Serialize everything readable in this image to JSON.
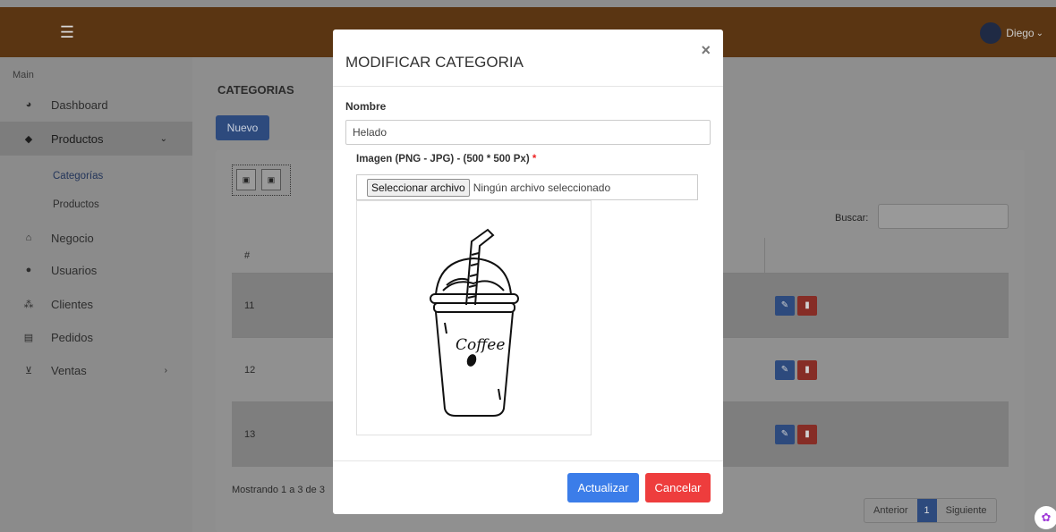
{
  "topbar": {
    "user_name": "Diego",
    "user_caret": "⌄"
  },
  "sidebar": {
    "section_label": "Main",
    "items": [
      {
        "label": "Dashboard",
        "icon": "pie-chart-icon"
      },
      {
        "label": "Productos",
        "icon": "tags-icon"
      },
      {
        "label": "Negocio",
        "icon": "home-icon"
      },
      {
        "label": "Usuarios",
        "icon": "user-icon"
      },
      {
        "label": "Clientes",
        "icon": "users-icon"
      },
      {
        "label": "Pedidos",
        "icon": "list-icon"
      },
      {
        "label": "Ventas",
        "icon": "cart-icon"
      }
    ],
    "subitems": [
      {
        "label": "Categorías"
      },
      {
        "label": "Productos"
      }
    ]
  },
  "main": {
    "title": "CATEGORIAS",
    "new_button": "Nuevo",
    "search_label": "Buscar:",
    "table": {
      "header_first": "#",
      "rows": [
        {
          "id": "11"
        },
        {
          "id": "12"
        },
        {
          "id": "13"
        }
      ]
    },
    "showing_text": "Mostrando 1 a 3 de 3",
    "pagination": {
      "prev": "Anterior",
      "current": "1",
      "next": "Siguiente"
    }
  },
  "modal": {
    "title": "MODIFICAR CATEGORIA",
    "close_symbol": "×",
    "nombre_label": "Nombre",
    "nombre_value": "Helado",
    "image_label": "Imagen (PNG - JPG) - (500 * 500 Px)",
    "required_mark": "*",
    "file_button": "Seleccionar archivo",
    "file_status": "Ningún archivo seleccionado",
    "preview_text": "Coffee",
    "update_button": "Actualizar",
    "cancel_button": "Cancelar"
  },
  "colors": {
    "topbar": "#5a3512",
    "primary": "#3b7de9",
    "danger": "#ee3d3d",
    "overlay_primary": "#2d4a7d",
    "overlay_danger": "#862d26"
  }
}
